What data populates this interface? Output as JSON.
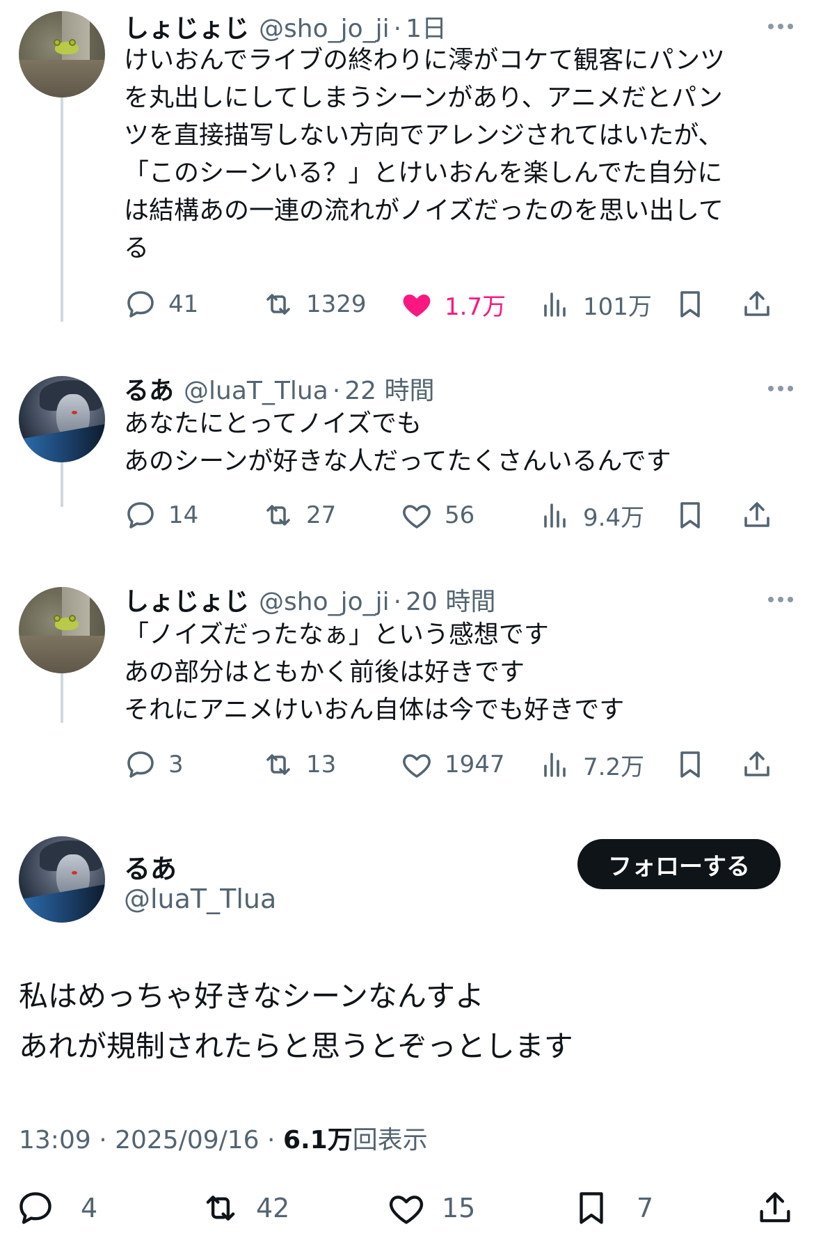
{
  "tweets": [
    {
      "name": "しょじょじ",
      "handle": "@sho_jo_ji",
      "dot": "·",
      "time": "1日",
      "lines": [
        "けいおんでライブの終わりに澪がコケて観客にパンツ",
        "を丸出しにしてしまうシーンがあり、アニメだとパン",
        "ツを直接描写しない方向でアレンジされてはいたが、",
        "「このシーンいる？」とけいおんを楽しんでた自分に",
        "は結構あの一連の流れがノイズだったのを思い出して",
        "る"
      ],
      "replies": "41",
      "retweets": "1329",
      "likes": "1.7万",
      "views": "101万",
      "liked": true
    },
    {
      "name": "るあ",
      "handle": "@luaT_Tlua",
      "dot": "·",
      "time": "22 時間",
      "lines": [
        "あなたにとってノイズでも",
        "あのシーンが好きな人だってたくさんいるんです"
      ],
      "replies": "14",
      "retweets": "27",
      "likes": "56",
      "views": "9.4万",
      "liked": false
    },
    {
      "name": "しょじょじ",
      "handle": "@sho_jo_ji",
      "dot": "·",
      "time": "20 時間",
      "lines": [
        "「ノイズだったなぁ」という感想です",
        "あの部分はともかく前後は好きです",
        "それにアニメけいおん自体は今でも好きです"
      ],
      "replies": "3",
      "retweets": "13",
      "likes": "1947",
      "views": "7.2万",
      "liked": false
    }
  ],
  "main": {
    "name": "るあ",
    "handle": "@luaT_Tlua",
    "follow_label": "フォローする",
    "lines": [
      "私はめっちゃ好きなシーンなんすよ",
      "あれが規制されたらと思うとぞっとします"
    ],
    "time": "13:09",
    "date": "2025/09/16",
    "views": "6.1万",
    "views_label": "回表示",
    "replies": "4",
    "retweets": "42",
    "likes": "15",
    "bookmarks": "7"
  },
  "colors": {
    "text": "#0f1419",
    "muted": "#536471",
    "like": "#f91880",
    "thread_line": "#cfd9de"
  }
}
